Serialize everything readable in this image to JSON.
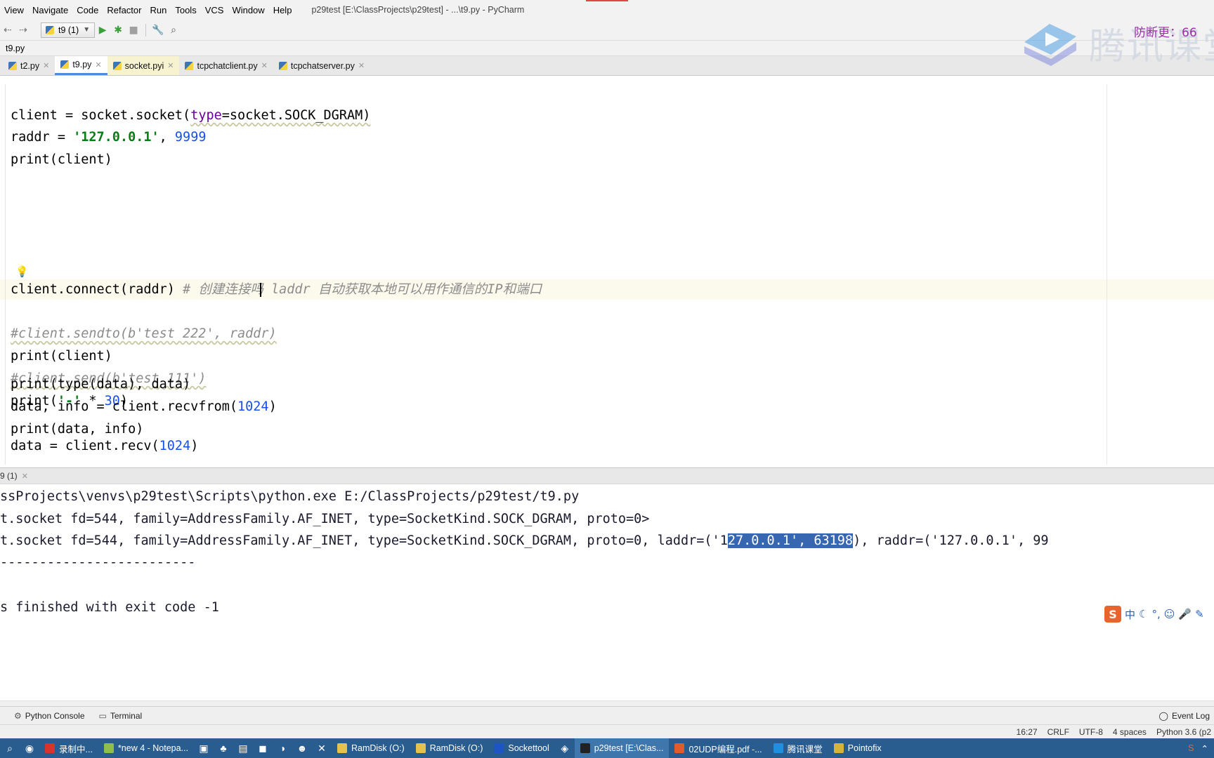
{
  "menu": {
    "items": [
      "View",
      "Navigate",
      "Code",
      "Refactor",
      "Run",
      "Tools",
      "VCS",
      "Window",
      "Help"
    ],
    "window_title": "p29test [E:\\ClassProjects\\p29test] - ...\\t9.py - PyCharm"
  },
  "toolbar": {
    "run_config": "t9 (1)"
  },
  "breadcrumb": {
    "file": "t9.py"
  },
  "tabs": [
    {
      "label": "t2.py",
      "active": false
    },
    {
      "label": "t9.py",
      "active": true
    },
    {
      "label": "socket.pyi",
      "active": false
    },
    {
      "label": "tcpchatclient.py",
      "active": false
    },
    {
      "label": "tcpchatserver.py",
      "active": false
    }
  ],
  "editor": {
    "lines": {
      "l1_a": "client = socket.socket(",
      "l1_b": "type",
      "l1_c": "=socket.SOCK_DGRAM)",
      "l2_a": "raddr = ",
      "l2_b": "'127.0.0.1'",
      "l2_c": ", ",
      "l2_d": "9999",
      "l3": "print(client)",
      "l5_a": "client.connect(raddr) ",
      "l5_b": "# 创建连接吗 laddr 自动获取本地可以用作通信的IP和端口",
      "l7": "#client.sendto(b'test 222', raddr)",
      "l8": "print(client)",
      "l9": "#client.send(b'test 111')",
      "l10_a": "print(",
      "l10_b": "'-'",
      "l10_c": " * ",
      "l10_d": "30",
      "l10_e": ")",
      "l12_a": "data = client.recv(",
      "l12_b": "1024",
      "l12_c": ")",
      "l13": "print(type(data), data)",
      "l14_a": "data, info = client.recvfrom(",
      "l14_b": "1024",
      "l14_c": ")",
      "l15": "print(data, info)"
    }
  },
  "run_panel": {
    "tab_label": "9 (1)",
    "output": {
      "o1": "ssProjects\\venvs\\p29test\\Scripts\\python.exe E:/ClassProjects/p29test/t9.py",
      "o2": "t.socket fd=544, family=AddressFamily.AF_INET, type=SocketKind.SOCK_DGRAM, proto=0>",
      "o3_a": "t.socket fd=544, family=AddressFamily.AF_INET, type=SocketKind.SOCK_DGRAM, proto=0, laddr=('1",
      "o3_sel": "27.0.0.1', 63198",
      "o3_b": "), raddr=('127.0.0.1', 99",
      "o4": "-------------------------",
      "o6": "s finished with exit code -1"
    }
  },
  "tool_tabs": {
    "python_console": "Python Console",
    "terminal": "Terminal",
    "event_log": "Event Log"
  },
  "status": {
    "position": "16:27",
    "line_sep": "CRLF",
    "encoding": "UTF-8",
    "indent": "4 spaces",
    "interpreter": "Python 3.6 (p2"
  },
  "taskbar": {
    "items": [
      {
        "label": "录制中...",
        "color": "#d9342b"
      },
      {
        "label": "*new 4 - Notepa...",
        "color": "#8fbf4a"
      },
      {
        "label": "RamDisk (O:)",
        "color": "#e6c14d"
      },
      {
        "label": "RamDisk (O:)",
        "color": "#e6c14d"
      },
      {
        "label": "Sockettool",
        "color": "#1d55c4"
      },
      {
        "label": "p29test [E:\\Clas...",
        "color": "#222222"
      },
      {
        "label": "02UDP编程.pdf -...",
        "color": "#e15b2b"
      },
      {
        "label": "腾讯课堂",
        "color": "#1f8fe0"
      },
      {
        "label": "Pointofix",
        "color": "#d8b33c"
      }
    ]
  },
  "watermark": {
    "text": "腾讯课堂",
    "notice": "防断更：66"
  },
  "ime": {
    "mode": "中"
  },
  "colors": {
    "selection": "#3767b1",
    "string": "#067d17",
    "number": "#1750eb",
    "comment": "#8c8c8c",
    "taskbar": "#2a5d8f"
  }
}
